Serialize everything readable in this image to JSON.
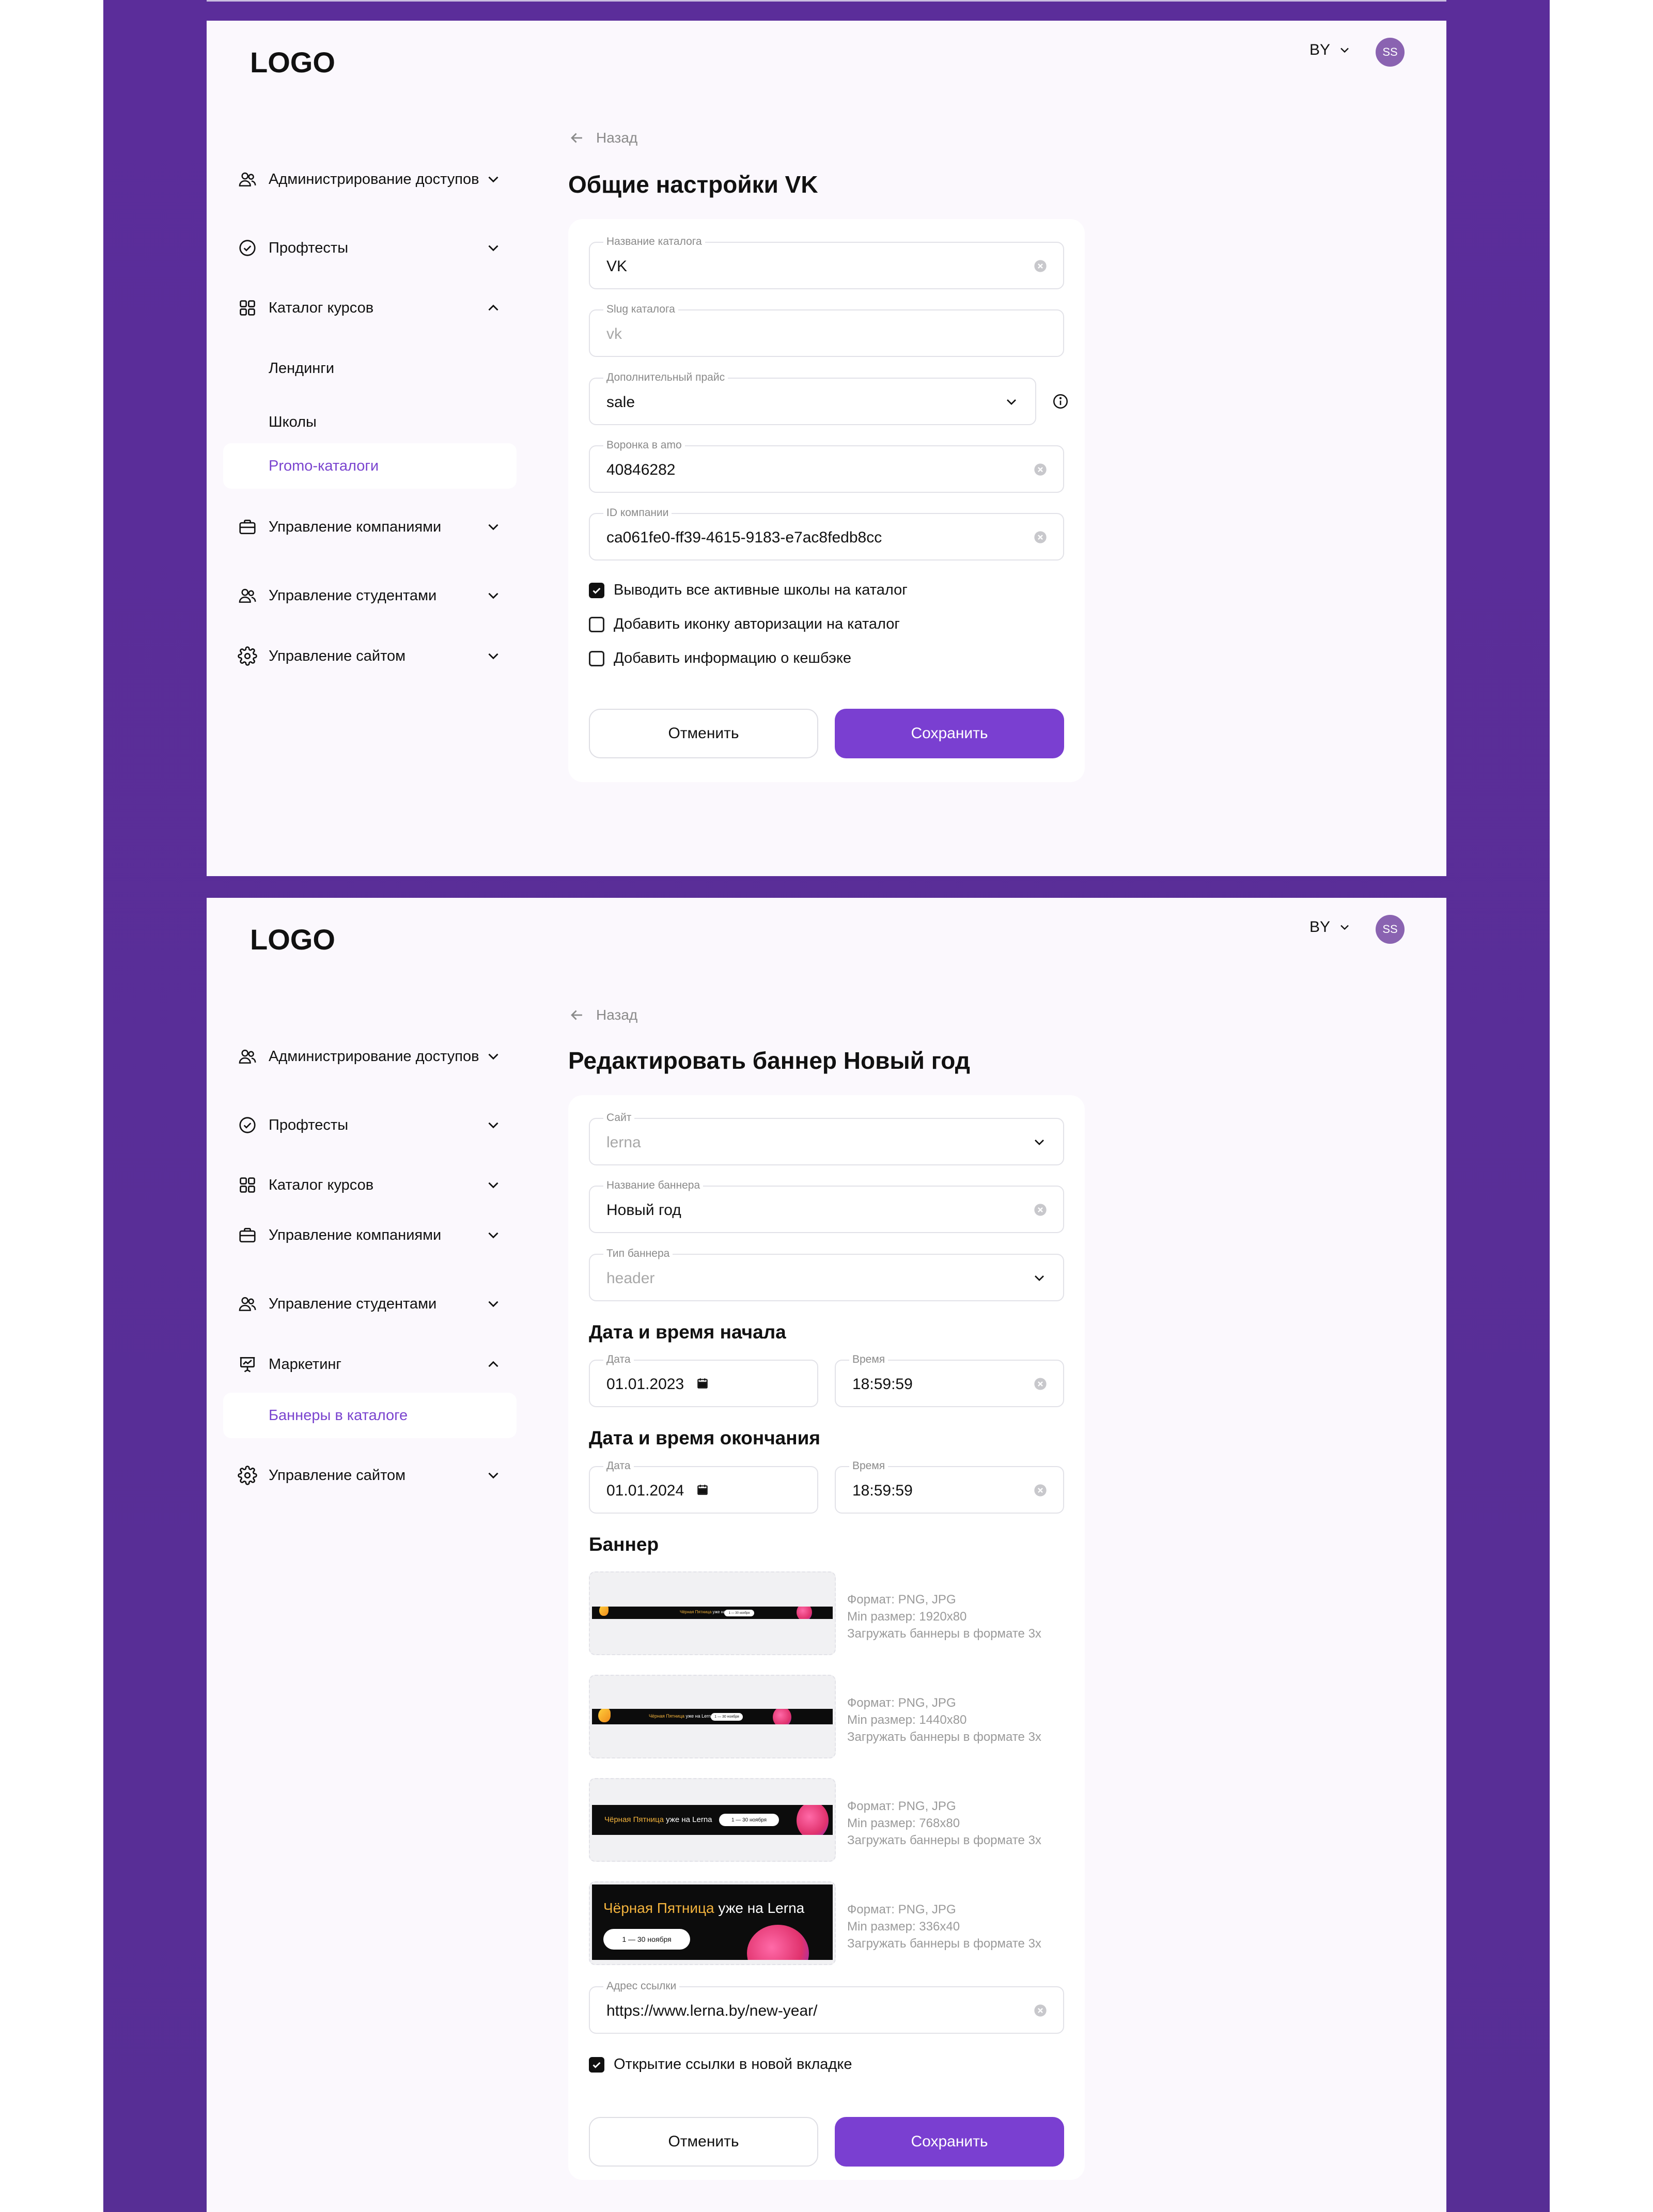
{
  "screen1": {
    "logo": "LOGO",
    "lang": "BY",
    "avatar": "SS",
    "sidebar": {
      "items": [
        {
          "label": "Администрирование доступов",
          "icon": "users-icon",
          "expanded": false
        },
        {
          "label": "Профтесты",
          "icon": "check-circle-icon",
          "expanded": false
        },
        {
          "label": "Каталог курсов",
          "icon": "grid-icon",
          "expanded": true,
          "children": [
            "Лендинги",
            "Школы",
            "Promo-каталоги"
          ],
          "active_child": "Promo-каталоги"
        },
        {
          "label": "Управление компаниями",
          "icon": "briefcase-icon",
          "expanded": false
        },
        {
          "label": "Управление студентами",
          "icon": "users-icon",
          "expanded": false
        },
        {
          "label": "Управление сайтом",
          "icon": "gear-icon",
          "expanded": false
        }
      ]
    },
    "back": "Назад",
    "title": "Общие настройки VK",
    "fields": {
      "catalog_name": {
        "label": "Название каталога",
        "value": "VK"
      },
      "slug": {
        "label": "Slug каталога",
        "value": "vk"
      },
      "extra_price": {
        "label": "Дополнительный прайс",
        "value": "sale"
      },
      "amo_funnel": {
        "label": "Воронка в amo",
        "value": "40846282"
      },
      "company_id": {
        "label": "ID компании",
        "value": "ca061fe0-ff39-4615-9183-e7ac8fedb8cc"
      }
    },
    "checkboxes": [
      {
        "label": "Выводить все активные школы на каталог",
        "checked": true
      },
      {
        "label": "Добавить иконку авторизации на каталог",
        "checked": false
      },
      {
        "label": "Добавить информацию о кешбэке",
        "checked": false
      }
    ],
    "cancel": "Отменить",
    "save": "Сохранить"
  },
  "screen2": {
    "logo": "LOGO",
    "lang": "BY",
    "avatar": "SS",
    "sidebar": {
      "items": [
        {
          "label": "Администрирование доступов",
          "icon": "users-icon"
        },
        {
          "label": "Профтесты",
          "icon": "check-circle-icon"
        },
        {
          "label": "Каталог курсов",
          "icon": "grid-icon"
        },
        {
          "label": "Управление компаниями",
          "icon": "briefcase-icon"
        },
        {
          "label": "Управление студентами",
          "icon": "users-icon"
        },
        {
          "label": "Маркетинг",
          "icon": "presentation-icon",
          "expanded": true,
          "children": [
            "Баннеры в каталоге"
          ],
          "active_child": "Баннеры в каталоге"
        },
        {
          "label": "Управление сайтом",
          "icon": "gear-icon"
        }
      ]
    },
    "back": "Назад",
    "title": "Редактировать баннер Новый год",
    "fields": {
      "site": {
        "label": "Сайт",
        "value": "lerna"
      },
      "banner_name": {
        "label": "Название баннера",
        "value": "Новый год"
      },
      "banner_type": {
        "label": "Тип баннера",
        "value": "header"
      }
    },
    "start": {
      "heading": "Дата и время начала",
      "date_label": "Дата",
      "date": "01.01.2023",
      "time_label": "Время",
      "time": "18:59:59"
    },
    "end": {
      "heading": "Дата и время окончания",
      "date_label": "Дата",
      "date": "01.01.2024",
      "time_label": "Время",
      "time": "18:59:59"
    },
    "banner_heading": "Баннер",
    "banner_text_yellow": "Чёрная Пятница",
    "banner_text_white": " уже на Lerna",
    "banner_pill": "1 — 30 ноября",
    "banners": [
      {
        "format": "Формат: PNG, JPG",
        "min": "Min размер: 1920x80",
        "hint": "Загружать баннеры в формате 3х"
      },
      {
        "format": "Формат: PNG, JPG",
        "min": "Min размер: 1440x80",
        "hint": "Загружать баннеры в формате 3х"
      },
      {
        "format": "Формат: PNG, JPG",
        "min": "Min размер: 768x80",
        "hint": "Загружать баннеры в формате 3х"
      },
      {
        "format": "Формат: PNG, JPG",
        "min": "Min размер: 336x40",
        "hint": "Загружать баннеры в формате 3х"
      }
    ],
    "link": {
      "label": "Адрес ссылки",
      "value": "https://www.lerna.by/new-year/"
    },
    "new_tab": {
      "label": "Открытие ссылки в новой вкладке",
      "checked": true
    },
    "cancel": "Отменить",
    "save": "Сохранить"
  }
}
